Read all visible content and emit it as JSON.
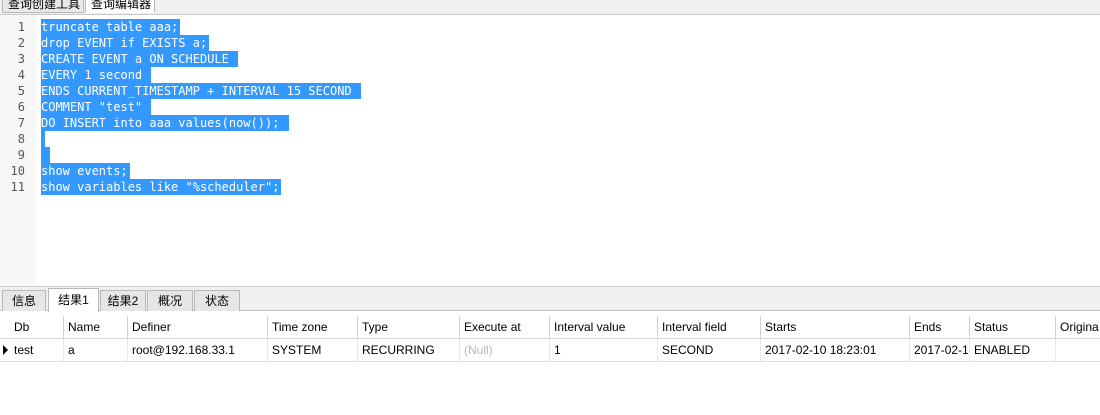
{
  "top_tabs": [
    "查询创建工具",
    "查询编辑器"
  ],
  "editor": {
    "lines": [
      {
        "n": "1",
        "text": "truncate table aaa;"
      },
      {
        "n": "2",
        "text": "drop EVENT if EXISTS a;"
      },
      {
        "n": "3",
        "text": "CREATE EVENT a ON SCHEDULE "
      },
      {
        "n": "4",
        "text": "EVERY 1 second "
      },
      {
        "n": "5",
        "text": "ENDS CURRENT_TIMESTAMP + INTERVAL 15 SECOND "
      },
      {
        "n": "6",
        "text": "COMMENT \"test\" "
      },
      {
        "n": "7",
        "text": "DO INSERT into aaa values(now()); "
      },
      {
        "n": "8",
        "text": ""
      },
      {
        "n": "9",
        "text": " "
      },
      {
        "n": "10",
        "text": "show events;"
      },
      {
        "n": "11",
        "text": "show variables like \"%scheduler\";"
      }
    ]
  },
  "result_tabs": [
    "信息",
    "结果1",
    "结果2",
    "概况",
    "状态"
  ],
  "grid": {
    "headers": [
      "Db",
      "Name",
      "Definer",
      "Time zone",
      "Type",
      "Execute at",
      "Interval value",
      "Interval field",
      "Starts",
      "Ends",
      "Status",
      "Origina"
    ],
    "row": [
      "test",
      "a",
      "root@192.168.33.1",
      "SYSTEM",
      "RECURRING",
      "(Null)",
      "1",
      "SECOND",
      "2017-02-10 18:23:01",
      "2017-02-1",
      "ENABLED",
      ""
    ]
  },
  "colors": {
    "selection": "#3399ff",
    "null_text": "#b8b8b8"
  }
}
